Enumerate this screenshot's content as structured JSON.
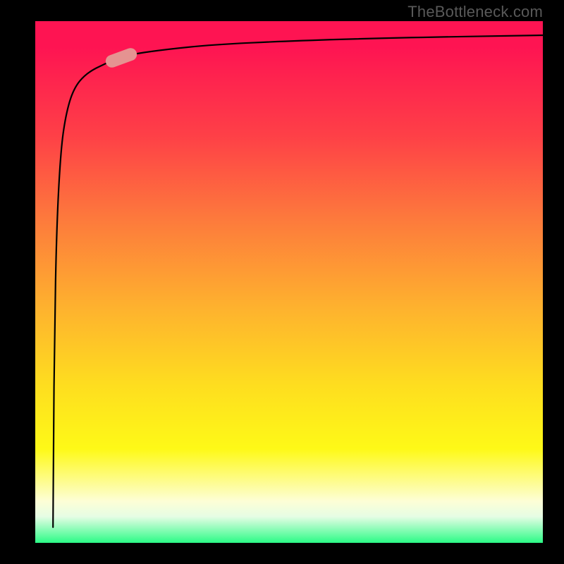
{
  "attribution": "TheBottleneck.com",
  "colors": {
    "frame": "#000000",
    "gradient_top": "#fe1452",
    "gradient_mid1": "#fd7a3c",
    "gradient_mid2": "#fede1f",
    "gradient_pale": "#fdfed6",
    "gradient_bottom": "#2bfb86",
    "curve": "#000000",
    "marker": "#e59391",
    "attribution_text": "#595959"
  },
  "chart_data": {
    "type": "line",
    "title": "",
    "xlabel": "",
    "ylabel": "",
    "xlim": [
      0,
      100
    ],
    "ylim": [
      0,
      100
    ],
    "series": [
      {
        "name": "curve",
        "x": [
          3.5,
          3.6,
          3.8,
          4.2,
          5.0,
          6.0,
          7.5,
          10,
          14,
          18,
          25,
          35,
          50,
          70,
          100
        ],
        "y": [
          3,
          20,
          40,
          60,
          75,
          82,
          87,
          90,
          92,
          93.5,
          94.5,
          95.5,
          96.2,
          96.8,
          97.3
        ]
      }
    ],
    "marker": {
      "x_center": 17,
      "y_center": 93,
      "angle_deg": -20
    }
  }
}
